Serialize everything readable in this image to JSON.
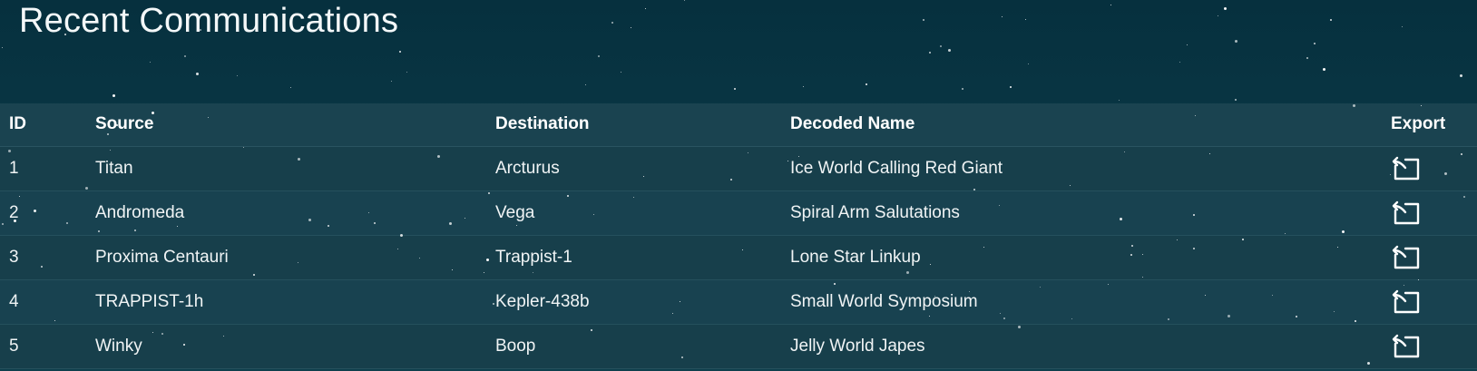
{
  "page": {
    "title": "Recent Communications"
  },
  "table": {
    "columns": {
      "id": "ID",
      "source": "Source",
      "destination": "Destination",
      "decoded_name": "Decoded Name",
      "export": "Export"
    },
    "rows": [
      {
        "id": "1",
        "source": "Titan",
        "destination": "Arcturus",
        "decoded_name": "Ice World Calling Red Giant"
      },
      {
        "id": "2",
        "source": "Andromeda",
        "destination": "Vega",
        "decoded_name": "Spiral Arm Salutations"
      },
      {
        "id": "3",
        "source": "Proxima Centauri",
        "destination": "Trappist-1",
        "decoded_name": "Lone Star Linkup"
      },
      {
        "id": "4",
        "source": "TRAPPIST-1h",
        "destination": "Kepler-438b",
        "decoded_name": "Small World Symposium"
      },
      {
        "id": "5",
        "source": "Winky",
        "destination": "Boop",
        "decoded_name": "Jelly World Japes"
      }
    ]
  },
  "icons": {
    "export": "export-icon"
  },
  "colors": {
    "background_top": "#06303e",
    "table_background": "#173f4c",
    "text": "#f2f6f7",
    "star": "#ffffff"
  }
}
